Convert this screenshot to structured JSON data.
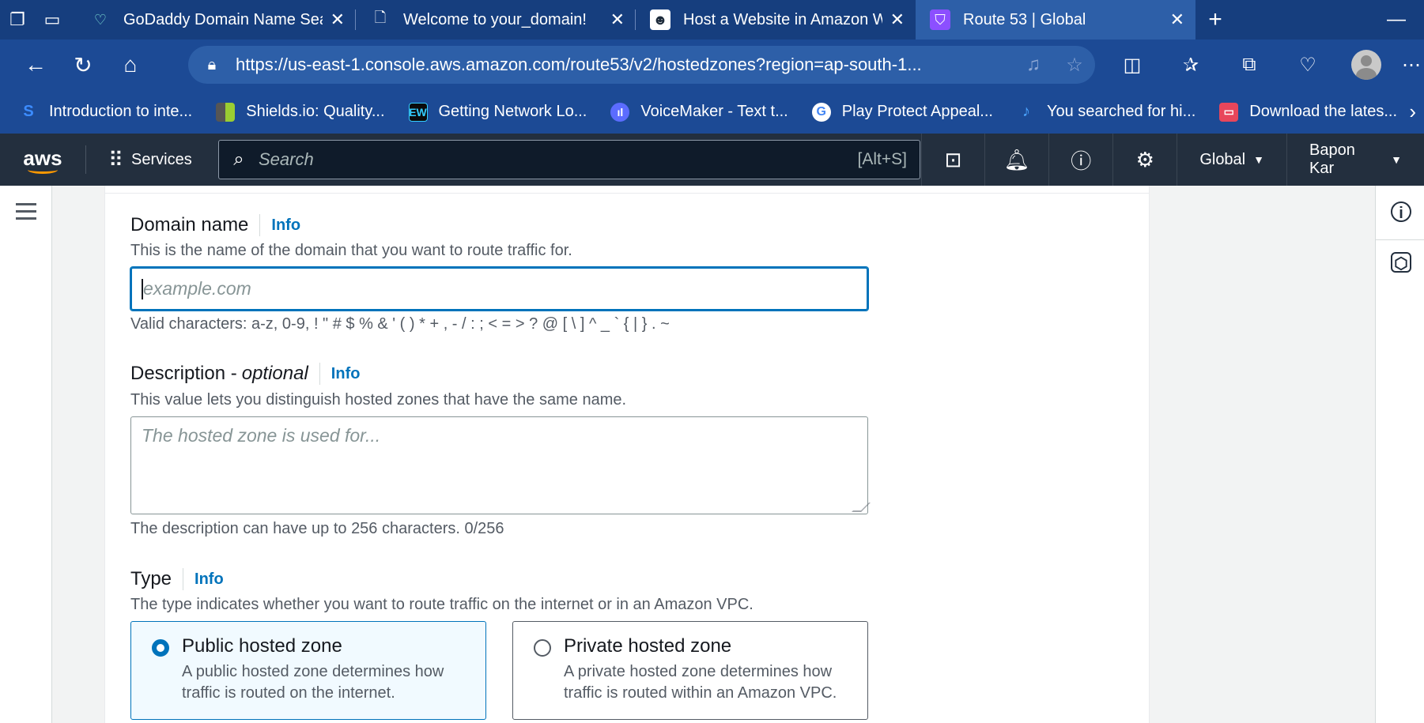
{
  "browser": {
    "tabs": [
      {
        "title": "GoDaddy Domain Name Sea",
        "favicon": "godaddy-icon"
      },
      {
        "title": "Welcome to your_domain!",
        "favicon": "page-icon"
      },
      {
        "title": "Host a Website in Amazon W",
        "favicon": "robot-icon"
      },
      {
        "title": "Route 53 | Global",
        "favicon": "route53-icon",
        "active": true
      }
    ],
    "url": "https://us-east-1.console.aws.amazon.com/route53/v2/hostedzones?region=ap-south-1...",
    "bookmarks": [
      {
        "label": "Introduction to inte..."
      },
      {
        "label": "Shields.io: Quality..."
      },
      {
        "label": "Getting Network Lo...",
        "badge": "EW"
      },
      {
        "label": "VoiceMaker - Text t..."
      },
      {
        "label": "Play Protect Appeal...",
        "badge": "G"
      },
      {
        "label": "You searched for hi..."
      },
      {
        "label": "Download the lates..."
      }
    ]
  },
  "aws_nav": {
    "logo": "aws",
    "services_label": "Services",
    "search_placeholder": "Search",
    "search_shortcut": "[Alt+S]",
    "region": "Global",
    "user": "Bapon Kar"
  },
  "form": {
    "domain": {
      "label": "Domain name",
      "info": "Info",
      "description": "This is the name of the domain that you want to route traffic for.",
      "placeholder": "example.com",
      "constraint": "Valid characters: a-z, 0-9, ! \" # $ % & ' ( ) * + , - / : ; < = > ? @ [ \\ ] ^ _ ` { | } . ~"
    },
    "description_field": {
      "label": "Description -",
      "optional": "optional",
      "info": "Info",
      "description": "This value lets you distinguish hosted zones that have the same name.",
      "placeholder": "The hosted zone is used for...",
      "constraint": "The description can have up to 256 characters. 0/256"
    },
    "type": {
      "label": "Type",
      "info": "Info",
      "description": "The type indicates whether you want to route traffic on the internet or in an Amazon VPC.",
      "options": [
        {
          "title": "Public hosted zone",
          "desc": "A public hosted zone determines how traffic is routed on the internet.",
          "selected": true
        },
        {
          "title": "Private hosted zone",
          "desc": "A private hosted zone determines how traffic is routed within an Amazon VPC.",
          "selected": false
        }
      ]
    }
  },
  "colors": {
    "aws_nav": "#232f3e",
    "accent": "#0073bb",
    "aws_orange": "#ff9900",
    "browser_chrome": "#1c4a95"
  }
}
